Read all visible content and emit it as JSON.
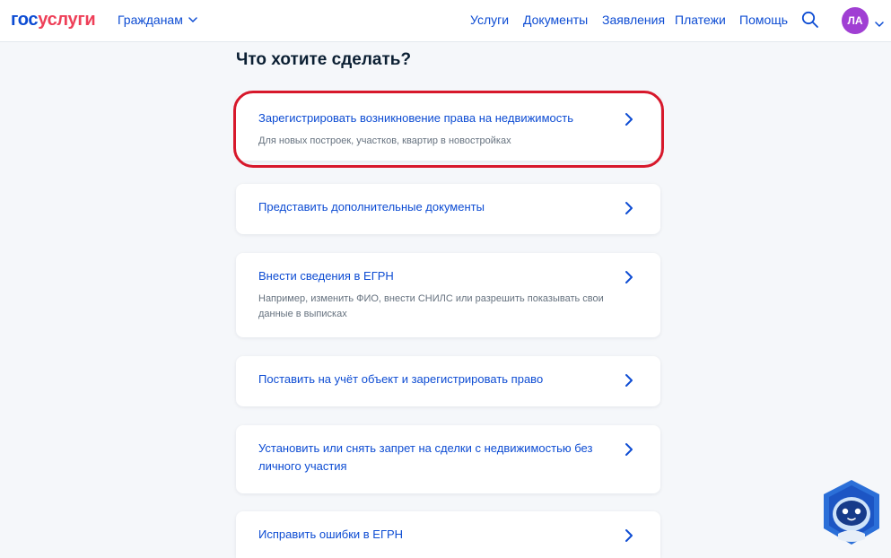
{
  "header": {
    "logo_part1": "гос",
    "logo_part2": "услуги",
    "audience_label": "Гражданам",
    "nav": [
      "Услуги",
      "Документы",
      "Заявления",
      "Платежи",
      "Помощь"
    ],
    "avatar_initials": "ЛА"
  },
  "main": {
    "title": "Что хотите сделать?",
    "options": [
      {
        "title": "Зарегистрировать возникновение права на недвижимость",
        "subtitle": "Для новых построек, участков, квартир в новостройках"
      },
      {
        "title": "Представить дополнительные документы"
      },
      {
        "title": "Внести сведения в ЕГРН",
        "subtitle": "Например, изменить ФИО, внести СНИЛС или разрешить показывать свои данные в выписках"
      },
      {
        "title": "Поставить на учёт объект и зарегистрировать право"
      },
      {
        "title": "Установить или снять запрет на сделки с недвижимостью без личного участия"
      },
      {
        "title": "Исправить ошибки в ЕГРН"
      }
    ]
  },
  "colors": {
    "brand_blue": "#0d4cd3",
    "brand_red": "#ee3f58",
    "avatar": "#a03fd3",
    "highlight": "#d7182b",
    "background": "#f5f7fa"
  },
  "icons": [
    "chevron-down-icon",
    "search-icon",
    "chevron-right-icon",
    "assistant-robot-icon"
  ]
}
